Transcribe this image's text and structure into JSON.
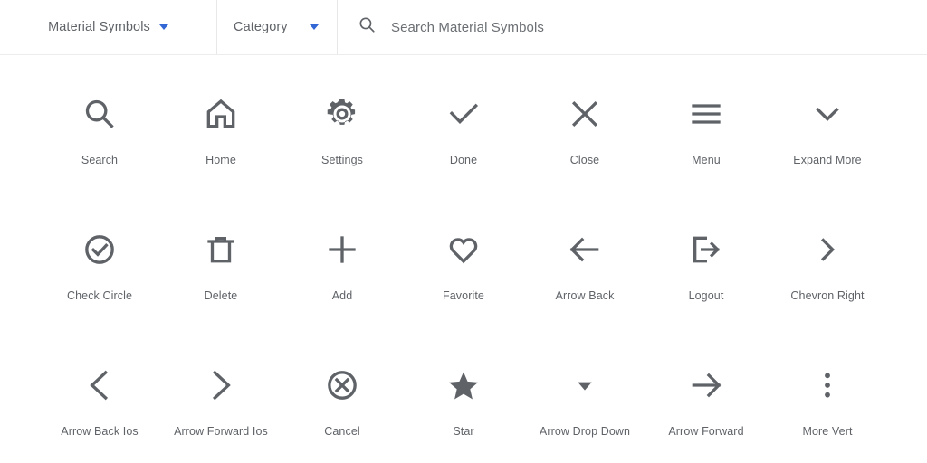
{
  "toolbar": {
    "family_select": {
      "label": "Material Symbols",
      "icon": "chevron-down-icon"
    },
    "category_select": {
      "label": "Category",
      "icon": "chevron-down-icon"
    },
    "search": {
      "placeholder": "Search Material Symbols",
      "value": "",
      "icon": "search-icon"
    }
  },
  "colors": {
    "icon": "#5f6368",
    "caret": "#3367d6",
    "divider": "#e8e8e8",
    "background": "#ffffff"
  },
  "grid": {
    "columns": 7,
    "rows": [
      [
        {
          "icon": "search-icon",
          "label": "Search"
        },
        {
          "icon": "home-icon",
          "label": "Home"
        },
        {
          "icon": "settings-icon",
          "label": "Settings"
        },
        {
          "icon": "done-icon",
          "label": "Done"
        },
        {
          "icon": "close-icon",
          "label": "Close"
        },
        {
          "icon": "menu-icon",
          "label": "Menu"
        },
        {
          "icon": "expand-more-icon",
          "label": "Expand More"
        }
      ],
      [
        {
          "icon": "check-circle-icon",
          "label": "Check Circle"
        },
        {
          "icon": "delete-icon",
          "label": "Delete"
        },
        {
          "icon": "add-icon",
          "label": "Add"
        },
        {
          "icon": "favorite-icon",
          "label": "Favorite"
        },
        {
          "icon": "arrow-back-icon",
          "label": "Arrow Back"
        },
        {
          "icon": "logout-icon",
          "label": "Logout"
        },
        {
          "icon": "chevron-right-icon",
          "label": "Chevron Right"
        }
      ],
      [
        {
          "icon": "arrow-back-ios-icon",
          "label": "Arrow Back Ios"
        },
        {
          "icon": "arrow-forward-ios-icon",
          "label": "Arrow Forward Ios"
        },
        {
          "icon": "cancel-icon",
          "label": "Cancel"
        },
        {
          "icon": "star-icon",
          "label": "Star"
        },
        {
          "icon": "arrow-drop-down-icon",
          "label": "Arrow Drop Down"
        },
        {
          "icon": "arrow-forward-icon",
          "label": "Arrow Forward"
        },
        {
          "icon": "more-vert-icon",
          "label": "More Vert"
        }
      ]
    ]
  }
}
